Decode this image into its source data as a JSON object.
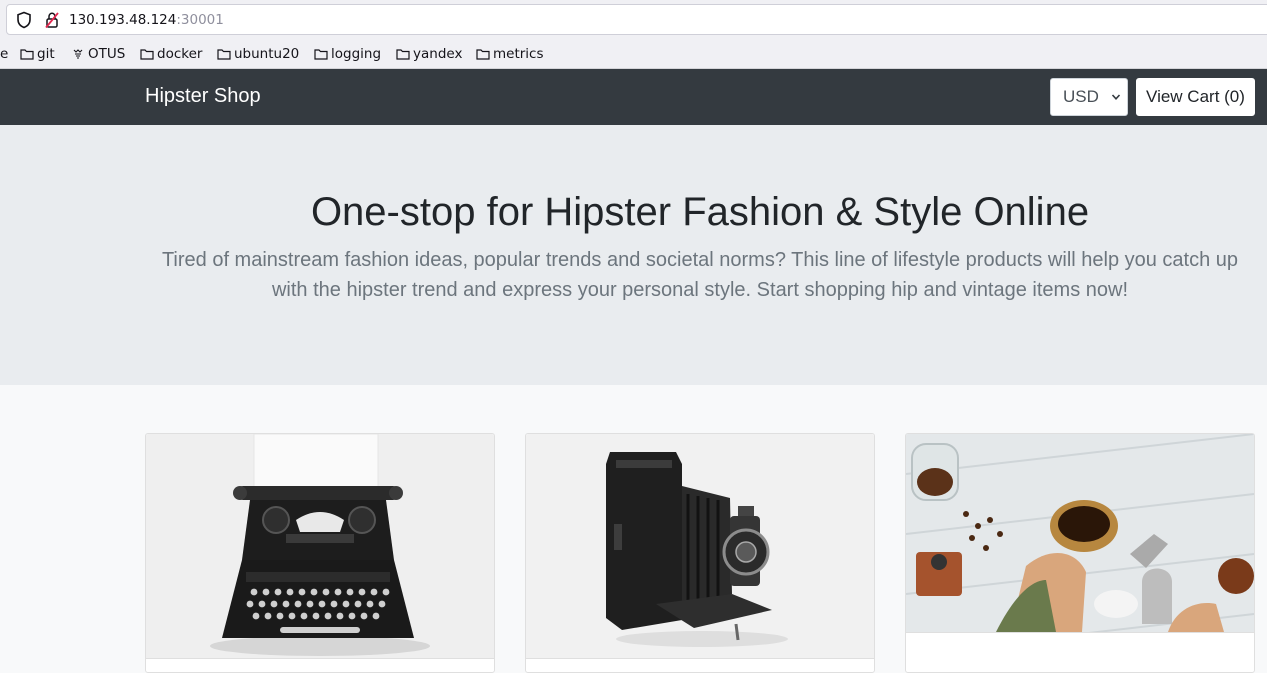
{
  "browser": {
    "url_host": "130.193.48.124",
    "url_port": ":30001",
    "bookmarks": [
      {
        "label": "e",
        "icon": "folder-icon"
      },
      {
        "label": "git",
        "icon": "folder-icon"
      },
      {
        "label": "OTUS",
        "icon": "otus-icon"
      },
      {
        "label": "docker",
        "icon": "folder-icon"
      },
      {
        "label": "ubuntu20",
        "icon": "folder-icon"
      },
      {
        "label": "logging",
        "icon": "folder-icon"
      },
      {
        "label": "yandex",
        "icon": "folder-icon"
      },
      {
        "label": "metrics",
        "icon": "folder-icon"
      }
    ]
  },
  "header": {
    "brand": "Hipster Shop",
    "currency": "USD",
    "cart_label": "View Cart (0)"
  },
  "hero": {
    "title": "One-stop for Hipster Fashion & Style Online",
    "lead": "Tired of mainstream fashion ideas, popular trends and societal norms? This line of lifestyle products will help you catch up with the hipster trend and express your personal style. Start shopping hip and vintage items now!"
  },
  "products": [
    {
      "image": "typewriter",
      "name": ""
    },
    {
      "image": "film-camera",
      "name": ""
    },
    {
      "image": "coffee-pour-over",
      "name": ""
    }
  ],
  "colors": {
    "navbar": "#343a40",
    "hero_bg": "#e9ecef",
    "page_bg": "#f8f9fa"
  }
}
